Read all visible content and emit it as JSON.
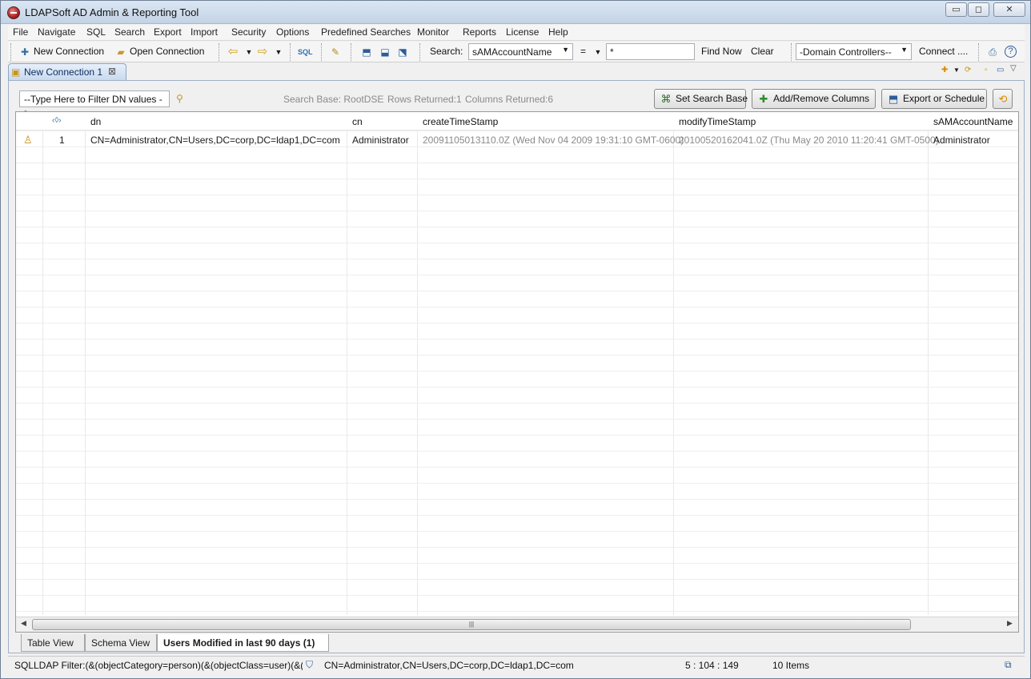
{
  "window": {
    "title": "LDAPSoft AD Admin & Reporting Tool",
    "minimize": "▭",
    "maximize": "◻",
    "close": "✕"
  },
  "menu": [
    "File",
    "Navigate",
    "SQL",
    "Search",
    "Export",
    "Import",
    "Security",
    "Options",
    "Predefined Searches",
    "Monitor",
    "Reports",
    "License",
    "Help"
  ],
  "toolbar": {
    "new_connection": "New Connection",
    "open_connection": "Open Connection",
    "search_label": "Search:",
    "search_attribute": "sAMAccountName",
    "operator": "=",
    "search_value": "*",
    "find_now": "Find Now",
    "clear": "Clear",
    "domain_controllers": "-Domain Controllers--",
    "connect": "Connect ...."
  },
  "editor_tab": {
    "label": "New Connection 1",
    "close": "⊠"
  },
  "filter": {
    "value": "--Type Here to Filter DN values --"
  },
  "status": {
    "search_base": "Search Base: RootDSE",
    "rows_returned": "Rows Returned:1",
    "columns_returned": "Columns Returned:6"
  },
  "buttons": {
    "set_search_base": "Set Search Base",
    "add_remove_columns": "Add/Remove Columns",
    "export_or_schedule": "Export or Schedule"
  },
  "table": {
    "columns": [
      "dn",
      "cn",
      "createTimeStamp",
      "modifyTimeStamp",
      "sAMAccountName"
    ],
    "rows": [
      {
        "index": "1",
        "dn": "CN=Administrator,CN=Users,DC=corp,DC=ldap1,DC=com",
        "cn": "Administrator",
        "createTimeStamp": "20091105013110.0Z (Wed Nov 04 2009 19:31:10 GMT-0600)",
        "modifyTimeStamp": "20100520162041.0Z (Thu May 20 2010 11:20:41 GMT-0500)",
        "sAMAccountName": "Administrator"
      }
    ]
  },
  "bottom_tabs": [
    "Table View",
    "Schema View",
    "Users Modified in last 90 days (1)"
  ],
  "statusbar": {
    "filter": "SQLLDAP Filter:(&(objectCategory=person)(&(objectClass=user)(&(",
    "dn": "CN=Administrator,CN=Users,DC=corp,DC=ldap1,DC=com",
    "position": "5 : 104 : 149",
    "items": "10 Items"
  }
}
